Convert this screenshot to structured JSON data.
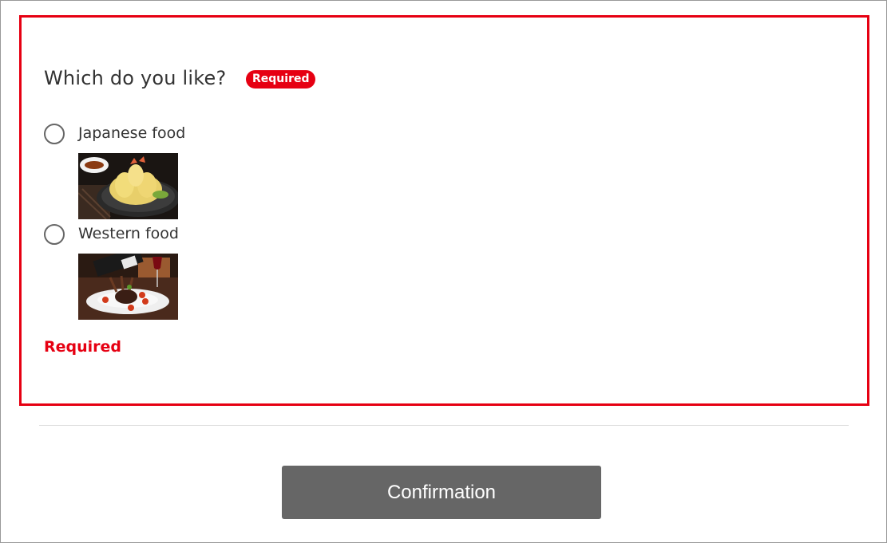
{
  "form": {
    "question": "Which do you like?",
    "required_badge": "Required",
    "error_message": "Required",
    "accent_color": "#e60012",
    "options": [
      {
        "label": "Japanese food",
        "selected": false,
        "image_icon": "tempura-photo"
      },
      {
        "label": "Western food",
        "selected": false,
        "image_icon": "steak-wine-photo"
      }
    ]
  },
  "footer": {
    "confirm_label": "Confirmation"
  }
}
